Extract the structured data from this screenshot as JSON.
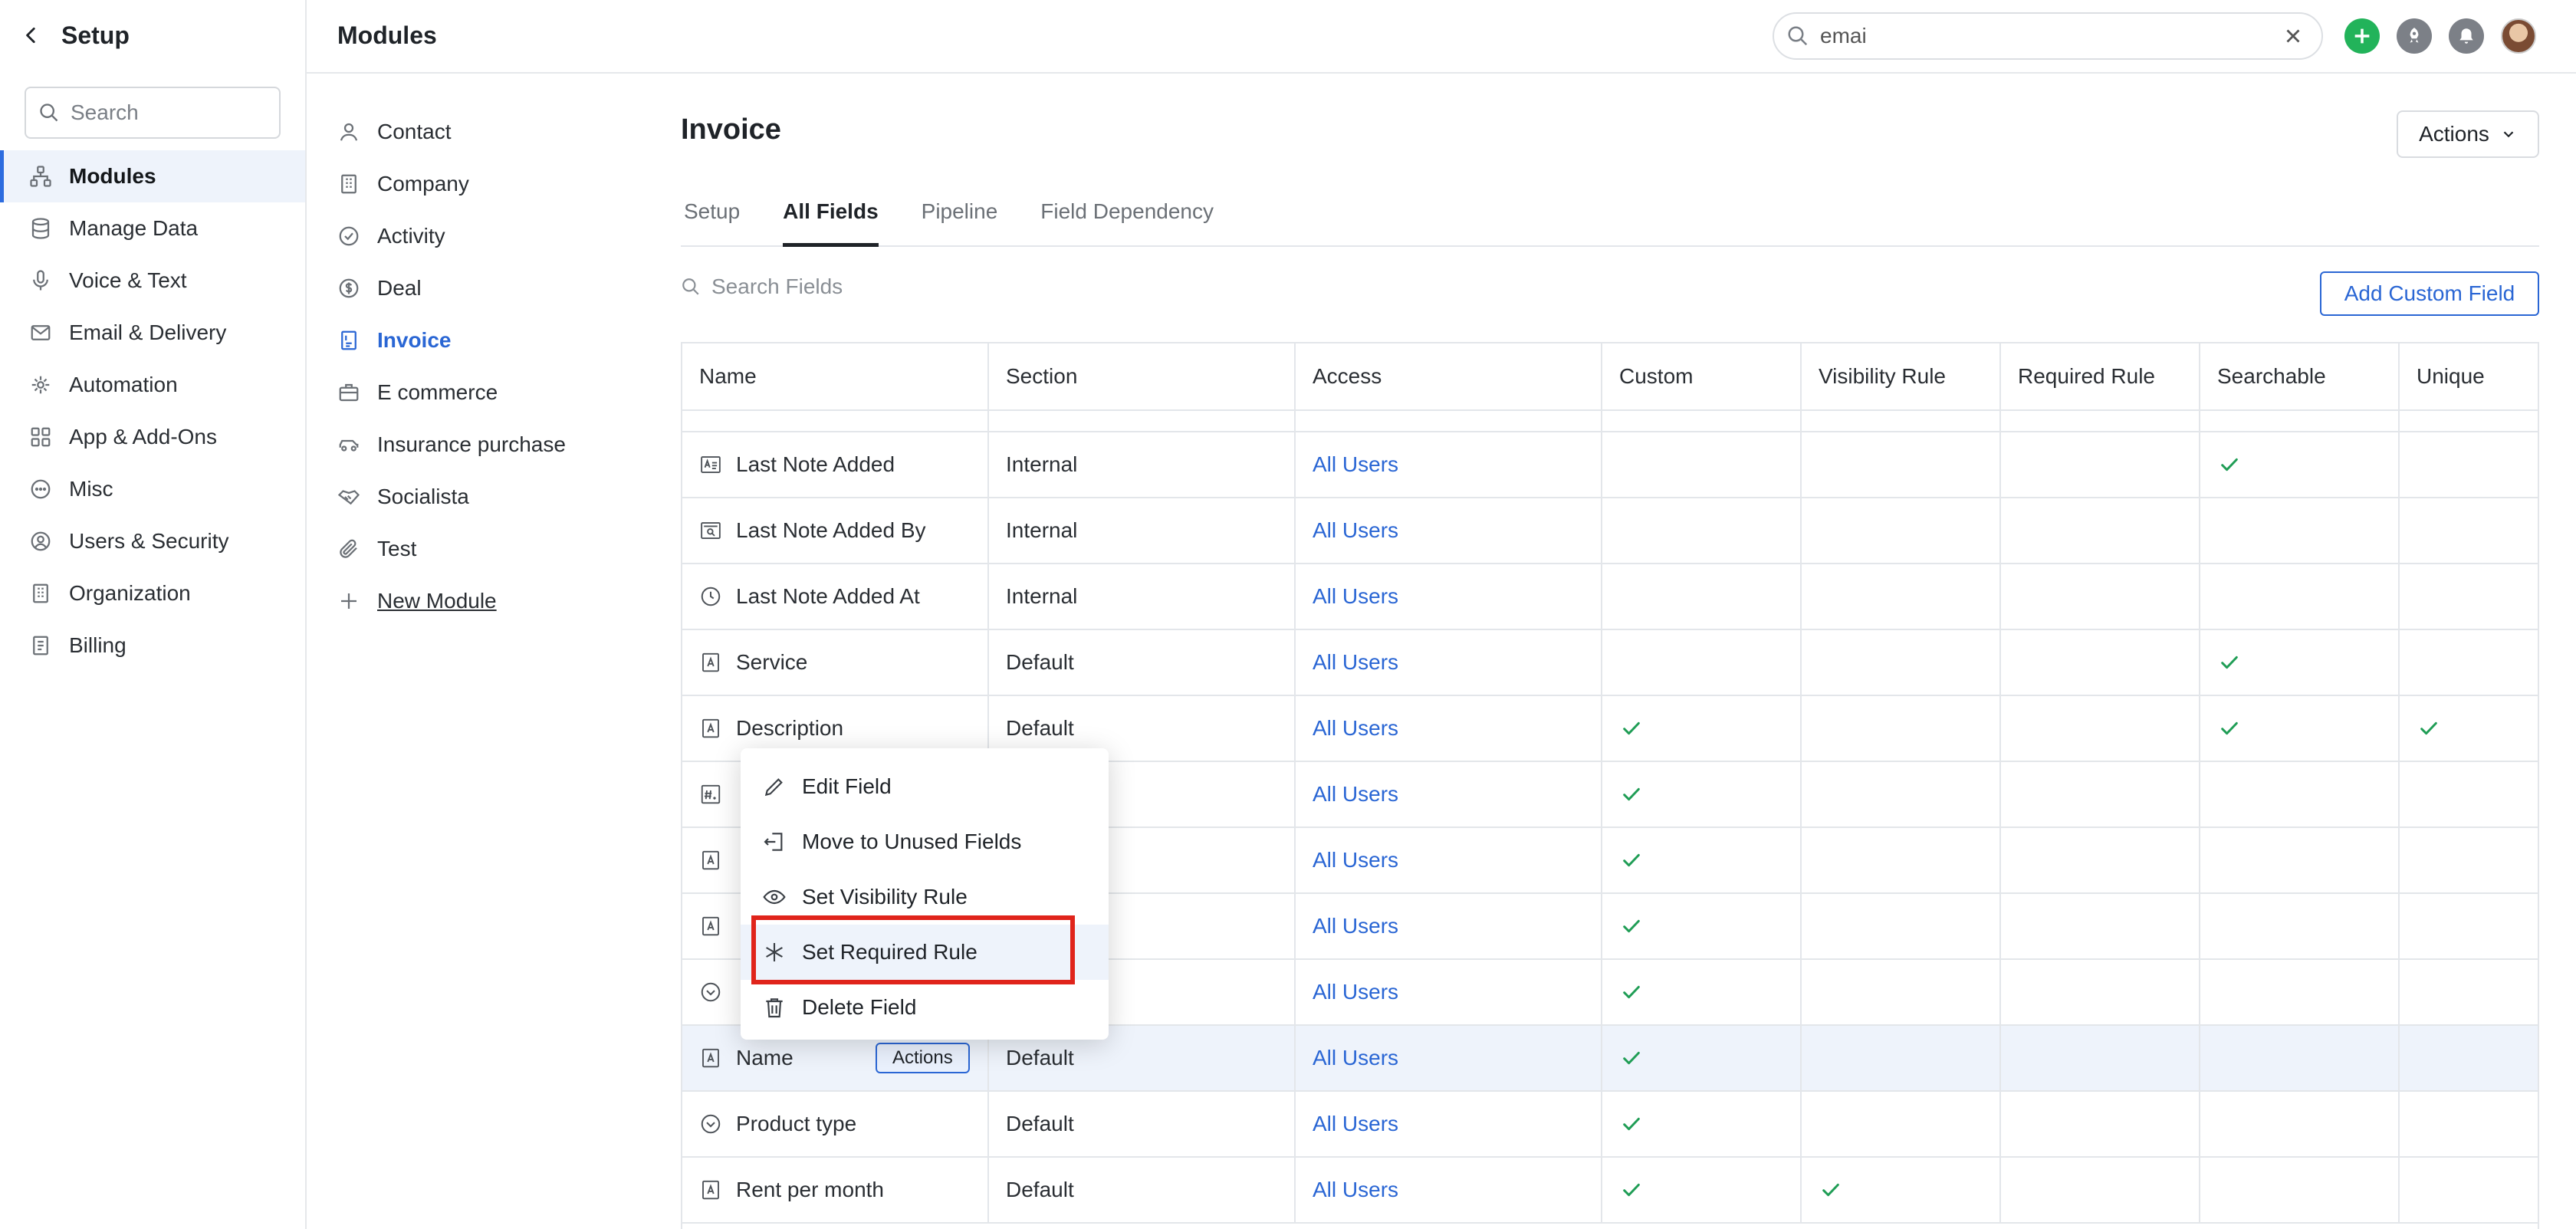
{
  "sidebar": {
    "back_title": "Setup",
    "search_placeholder": "Search",
    "items": [
      {
        "label": "Modules",
        "icon": "sitemap-icon",
        "active": true
      },
      {
        "label": "Manage Data",
        "icon": "database-icon"
      },
      {
        "label": "Voice & Text",
        "icon": "microphone-icon"
      },
      {
        "label": "Email & Delivery",
        "icon": "envelope-icon"
      },
      {
        "label": "Automation",
        "icon": "automation-icon"
      },
      {
        "label": "App & Add-Ons",
        "icon": "apps-grid-icon"
      },
      {
        "label": "Misc",
        "icon": "ellipsis-circle-icon"
      },
      {
        "label": "Users & Security",
        "icon": "user-shield-icon"
      },
      {
        "label": "Organization",
        "icon": "building-icon"
      },
      {
        "label": "Billing",
        "icon": "receipt-icon"
      }
    ]
  },
  "header": {
    "breadcrumb": "Modules",
    "search_value": "emai"
  },
  "modules": {
    "items": [
      {
        "label": "Contact",
        "icon": "user-icon"
      },
      {
        "label": "Company",
        "icon": "building-icon"
      },
      {
        "label": "Activity",
        "icon": "check-circle-icon"
      },
      {
        "label": "Deal",
        "icon": "dollar-circle-icon"
      },
      {
        "label": "Invoice",
        "icon": "invoice-icon",
        "active": true
      },
      {
        "label": "E commerce",
        "icon": "briefcase-icon"
      },
      {
        "label": "Insurance purchase",
        "icon": "car-icon"
      },
      {
        "label": "Socialista",
        "icon": "handshake-icon"
      },
      {
        "label": "Test",
        "icon": "paperclip-icon"
      }
    ],
    "new_label": "New Module"
  },
  "main": {
    "title": "Invoice",
    "actions_label": "Actions",
    "tabs": [
      "Setup",
      "All Fields",
      "Pipeline",
      "Field Dependency"
    ],
    "active_tab": "All Fields",
    "search_placeholder": "Search Fields",
    "add_button": "Add Custom Field",
    "columns": [
      "Name",
      "Section",
      "Access",
      "Custom",
      "Visibility Rule",
      "Required Rule",
      "Searchable",
      "Unique"
    ],
    "rows": [
      {
        "name": "Last Note Added",
        "icon": "text-field-icon",
        "section": "Internal",
        "access": "All Users",
        "custom": false,
        "visibility": false,
        "required": false,
        "searchable": true,
        "unique": false
      },
      {
        "name": "Last Note Added By",
        "icon": "lookup-field-icon",
        "section": "Internal",
        "access": "All Users",
        "custom": false,
        "visibility": false,
        "required": false,
        "searchable": false,
        "unique": false
      },
      {
        "name": "Last Note Added At",
        "icon": "clock-icon",
        "section": "Internal",
        "access": "All Users",
        "custom": false,
        "visibility": false,
        "required": false,
        "searchable": false,
        "unique": false
      },
      {
        "name": "Service",
        "icon": "single-line-text-icon",
        "section": "Default",
        "access": "All Users",
        "custom": false,
        "visibility": false,
        "required": false,
        "searchable": true,
        "unique": false
      },
      {
        "name": "Description",
        "icon": "single-line-text-icon",
        "section": "Default",
        "access": "All Users",
        "custom": true,
        "visibility": false,
        "required": false,
        "searchable": true,
        "unique": true
      },
      {
        "name": "",
        "icon": "number-field-icon",
        "section": "",
        "access": "All Users",
        "custom": true,
        "visibility": false,
        "required": false,
        "searchable": false,
        "unique": false
      },
      {
        "name": "",
        "icon": "single-line-text-icon",
        "section": "",
        "access": "All Users",
        "custom": true,
        "visibility": false,
        "required": false,
        "searchable": false,
        "unique": false
      },
      {
        "name": "",
        "icon": "single-line-text-icon",
        "section": "",
        "access": "All Users",
        "custom": true,
        "visibility": false,
        "required": false,
        "searchable": false,
        "unique": false
      },
      {
        "name": "",
        "icon": "dropdown-field-icon",
        "section": "",
        "access": "All Users",
        "custom": true,
        "visibility": false,
        "required": false,
        "searchable": false,
        "unique": false
      },
      {
        "name": "Name",
        "icon": "single-line-text-icon",
        "section": "Default",
        "access": "All Users",
        "custom": true,
        "visibility": false,
        "required": false,
        "searchable": false,
        "unique": false,
        "highlighted": true,
        "row_action": "Actions"
      },
      {
        "name": "Product type",
        "icon": "dropdown-field-icon",
        "section": "Default",
        "access": "All Users",
        "custom": true,
        "visibility": false,
        "required": false,
        "searchable": false,
        "unique": false
      },
      {
        "name": "Rent per month",
        "icon": "single-line-text-icon",
        "section": "Default",
        "access": "All Users",
        "custom": true,
        "visibility": true,
        "required": false,
        "searchable": false,
        "unique": false
      }
    ]
  },
  "context_menu": {
    "items": [
      {
        "label": "Edit Field",
        "icon": "pencil-icon"
      },
      {
        "label": "Move to Unused Fields",
        "icon": "move-out-icon"
      },
      {
        "label": "Set Visibility Rule",
        "icon": "eye-icon"
      },
      {
        "label": "Set Required Rule",
        "icon": "asterisk-icon",
        "hovered": true
      },
      {
        "label": "Delete Field",
        "icon": "trash-icon"
      }
    ]
  },
  "colors": {
    "accent": "#2a66d4",
    "check": "#1f9d55",
    "highlight_box": "#e0241b",
    "add_button_green": "#22b35a"
  }
}
